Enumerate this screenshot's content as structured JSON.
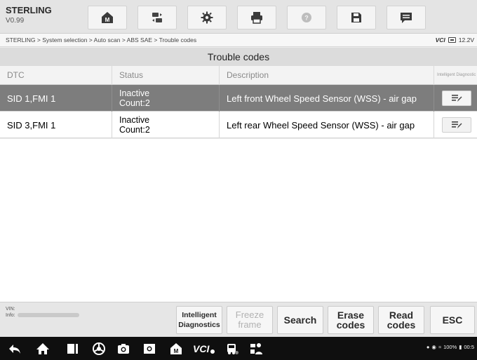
{
  "app": {
    "brand": "STERLING",
    "version": "V0.99"
  },
  "toolbar": {
    "icons": [
      "home-icon",
      "vehicle-swap-icon",
      "gear-icon",
      "printer-icon",
      "help-icon",
      "save-icon",
      "message-icon"
    ]
  },
  "breadcrumb": "STERLING > System selection > Auto scan > ABS SAE > Trouble codes",
  "vci": {
    "label": "VCI",
    "voltage": "12.2V"
  },
  "page_title": "Trouble codes",
  "table": {
    "headers": [
      "DTC",
      "Status",
      "Description",
      "Intelligent Diagnostic"
    ],
    "rows": [
      {
        "dtc": "SID 1,FMI 1",
        "status_line1": "Inactive",
        "status_line2": "Count:2",
        "description": "Left front Wheel Speed Sensor (WSS) - air gap",
        "selected": true
      },
      {
        "dtc": "SID 3,FMI 1",
        "status_line1": "Inactive",
        "status_line2": "Count:2",
        "description": "Left rear Wheel Speed Sensor (WSS) - air gap",
        "selected": false
      }
    ]
  },
  "footer": {
    "vin_label": "VIN:",
    "info_label": "Info:",
    "buttons": {
      "intelligent_line1": "Intelligent",
      "intelligent_line2": "Diagnostics",
      "freeze_line1": "Freeze",
      "freeze_line2": "frame",
      "search": "Search",
      "erase_line1": "Erase",
      "erase_line2": "codes",
      "read_line1": "Read",
      "read_line2": "codes",
      "esc": "ESC"
    }
  },
  "system_bar": {
    "icons": [
      "back-icon",
      "home-icon",
      "recents-icon",
      "browser-icon",
      "camera-icon",
      "screen-brightness-icon",
      "maxisys-home-icon",
      "vci-icon",
      "truck-icon",
      "remote-support-icon"
    ],
    "vci_label": "VCI",
    "battery": "100%",
    "time": "00:5"
  },
  "colors": {
    "selected_row": "#7d7d7d",
    "nav_bg": "#0f0f0f"
  }
}
